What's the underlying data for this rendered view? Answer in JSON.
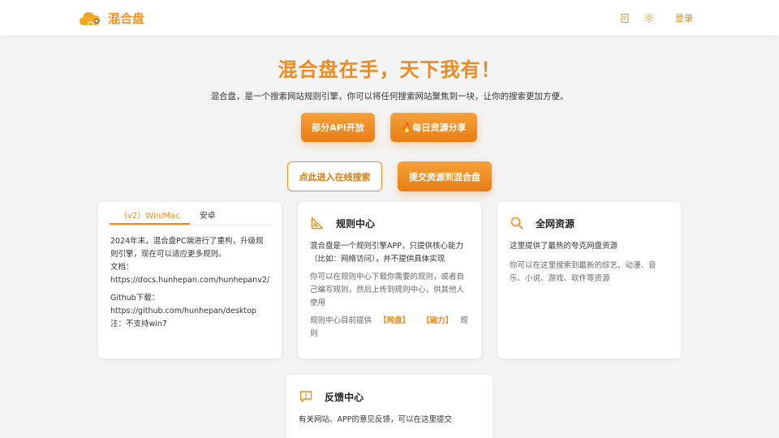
{
  "header": {
    "brand": "混合盘",
    "login": "登录"
  },
  "hero": {
    "title": "混合盘在手，天下我有！",
    "subtitle": "混合盘，是一个搜索网站规则引擎，你可以将任何搜索网站聚焦到一块，让你的搜索更加方便。"
  },
  "buttons": {
    "api": "部分API开放",
    "daily": "🔥每日资源分享",
    "search": "点此进入在线搜索",
    "submit": "提交资源到混合盘"
  },
  "client_card": {
    "tabs": [
      "（v2）Win/Mac",
      "安卓"
    ],
    "desc": "2024年末，混合盘PC端进行了重构，升级规则引擎，现在可以适应更多规则。",
    "docs_label": "文档：",
    "docs_url": "https://docs.hunhepan.com/hunhepanv2/",
    "github_label": "Github下载：",
    "github_url": "https://github.com/hunhepan/desktop",
    "note": "注：不支持win7"
  },
  "rules_card": {
    "title": "规则中心",
    "p1": "混合盘是一个规则引擎APP，只提供核心能力（比如：网络访问），并不提供具体实现",
    "p2": "你可以在规则中心下载你需要的规则，或者自己编写规则，然后上传到规则中心，供其他人使用",
    "p3_prefix": "规则中心目前提供",
    "tag1": "【网盘】",
    "tag2": "【磁力】",
    "p3_suffix": "规则"
  },
  "resources_card": {
    "title": "全网资源",
    "p1": "这里提供了最热的夸克网盘资源",
    "p2": "你可以在这里搜索到最新的综艺、动漫、音乐、小说、游戏、软件等资源"
  },
  "feedback_card": {
    "title": "反馈中心",
    "p1": "有关网站、APP的意见反馈，可以在这里提交"
  },
  "colors": {
    "accent": "#f08a1e",
    "accent_dark": "#e77d14"
  }
}
